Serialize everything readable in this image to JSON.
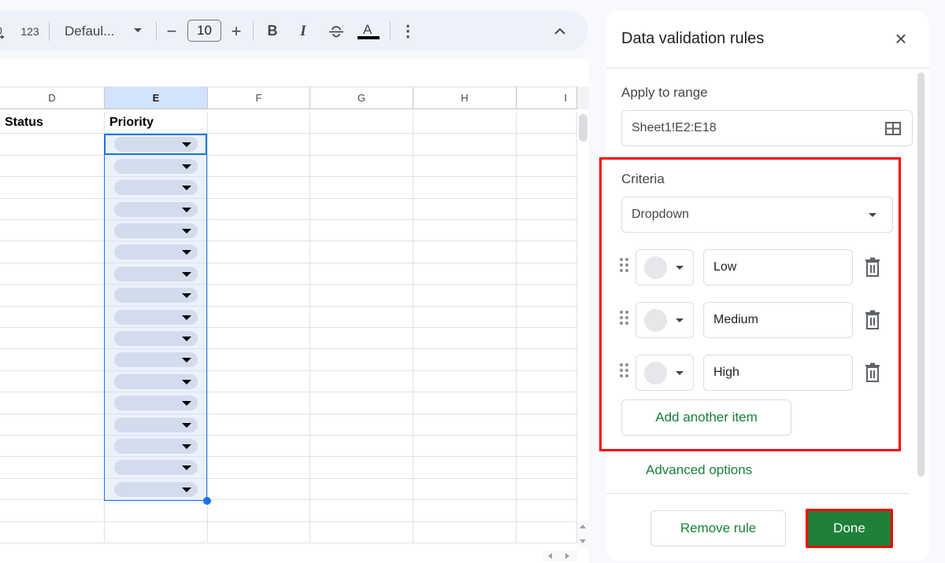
{
  "toolbar": {
    "number_format_label": "123",
    "font_family": "Defaul...",
    "font_size": "10",
    "decrease_label": "−",
    "increase_label": "+",
    "bold_label": "B",
    "italic_label": "I",
    "more_label": "⋮",
    "collapse_label": "⌃"
  },
  "sheet": {
    "columns": [
      "D",
      "E",
      "F",
      "G",
      "H",
      "I"
    ],
    "selected_column": "E",
    "header_row": {
      "D": "Status",
      "E": "Priority"
    },
    "dropdown_cells_count": 17,
    "selected_range": "E2:E18"
  },
  "panel": {
    "title": "Data validation rules",
    "apply_to_range_label": "Apply to range",
    "range_value": "Sheet1!E2:E18",
    "criteria_label": "Criteria",
    "criteria_value": "Dropdown",
    "items": [
      {
        "value": "Low",
        "color": "#e6e7ea"
      },
      {
        "value": "Medium",
        "color": "#e6e7ea"
      },
      {
        "value": "High",
        "color": "#e6e7ea"
      }
    ],
    "add_item_label": "Add another item",
    "advanced_options_label": "Advanced options",
    "remove_rule_label": "Remove rule",
    "done_label": "Done"
  },
  "colors": {
    "accent_green": "#188038",
    "done_bg": "#1e8039",
    "highlight_red": "#ff0000",
    "selection_blue": "#1a73e8"
  }
}
